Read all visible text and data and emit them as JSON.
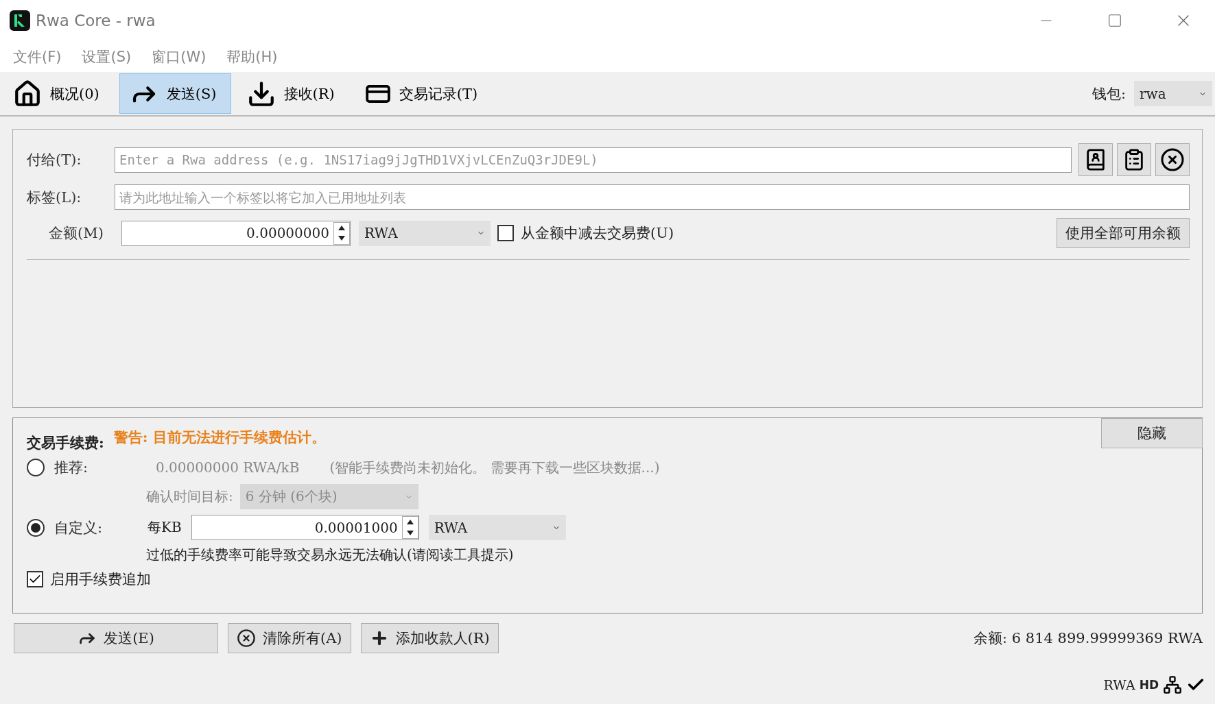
{
  "window": {
    "title": "Rwa Core - rwa"
  },
  "menu": [
    "文件(F)",
    "设置(S)",
    "窗口(W)",
    "帮助(H)"
  ],
  "tabs": [
    {
      "label": "概况(0)",
      "selected": false
    },
    {
      "label": "发送(S)",
      "selected": true
    },
    {
      "label": "接收(R)",
      "selected": false
    },
    {
      "label": "交易记录(T)",
      "selected": false
    }
  ],
  "wallet": {
    "label": "钱包:",
    "value": "rwa"
  },
  "recipient": {
    "pay_to_label": "付给(T):",
    "pay_to_placeholder": "Enter a Rwa address (e.g. 1NS17iag9jJgTHD1VXjvLCEnZuQ3rJDE9L)",
    "label_label": "标签(L):",
    "label_placeholder": "请为此地址输入一个标签以将它加入已用地址列表",
    "amount_label": "金额(M)",
    "amount_value": "0.00000000",
    "unit": "RWA",
    "subtract_fee": {
      "label": "从金额中减去交易费(U)",
      "checked": false
    },
    "use_all_button": "使用全部可用余额"
  },
  "fee": {
    "title": "交易手续费:",
    "warning": "警告: 目前无法进行手续费估计。",
    "hide_button": "隐藏",
    "options": [
      {
        "kind": "recommended",
        "label": "推荐:",
        "selected": false,
        "rate": "0.00000000 RWA/kB",
        "note": "(智能手续费尚未初始化。 需要再下载一些区块数据...)",
        "target_label": "确认时间目标:",
        "target_value": "6 分钟 (6个块)"
      },
      {
        "kind": "custom",
        "label": "自定义:",
        "selected": true,
        "per_kb": "每KB",
        "value": "0.00001000",
        "unit": "RWA",
        "hint": "过低的手续费率可能导致交易永远无法确认(请阅读工具提示)"
      }
    ],
    "rbf": {
      "label": "启用手续费追加",
      "checked": true
    }
  },
  "actions": [
    {
      "label": "发送(E)"
    },
    {
      "label": "清除所有(A)"
    },
    {
      "label": "添加收款人(R)"
    }
  ],
  "balance": "余额: 6 814 899.99999369 RWA",
  "status_bar": {
    "unit": "RWA",
    "hd": "HD"
  }
}
